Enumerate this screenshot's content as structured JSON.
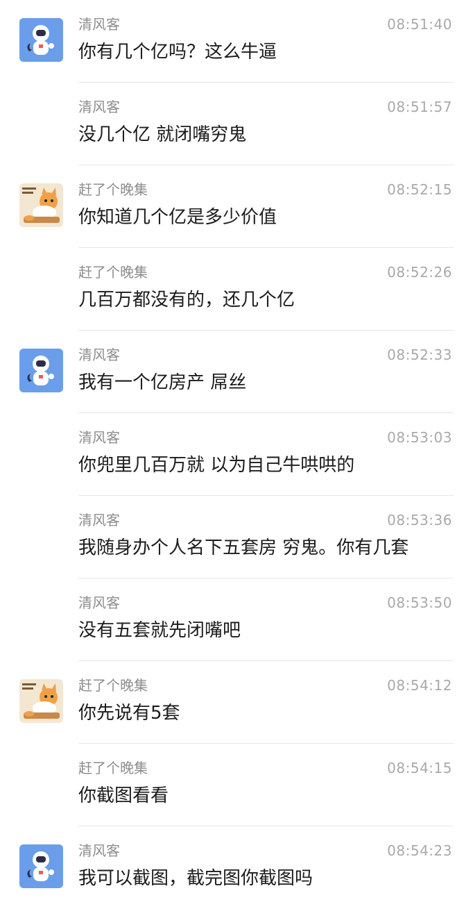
{
  "messages": [
    {
      "sender": "清风客",
      "time": "08:51:40",
      "text": "你有几个亿吗？这么牛逼",
      "avatar": "astronaut-avatar"
    },
    {
      "sender": "清风客",
      "time": "08:51:57",
      "text": "没几个亿 就闭嘴穷鬼",
      "avatar": ""
    },
    {
      "sender": "赶了个晚集",
      "time": "08:52:15",
      "text": "你知道几个亿是多少价值",
      "avatar": "cat-avatar"
    },
    {
      "sender": "赶了个晚集",
      "time": "08:52:26",
      "text": "几百万都没有的，还几个亿",
      "avatar": ""
    },
    {
      "sender": "清风客",
      "time": "08:52:33",
      "text": "我有一个亿房产 屌丝",
      "avatar": "astronaut-avatar"
    },
    {
      "sender": "清风客",
      "time": "08:53:03",
      "text": "你兜里几百万就 以为自己牛哄哄的",
      "avatar": ""
    },
    {
      "sender": "清风客",
      "time": "08:53:36",
      "text": "我随身办个人名下五套房 穷鬼。你有几套",
      "avatar": ""
    },
    {
      "sender": "清风客",
      "time": "08:53:50",
      "text": "没有五套就先闭嘴吧",
      "avatar": ""
    },
    {
      "sender": "赶了个晚集",
      "time": "08:54:12",
      "text": "你先说有5套",
      "avatar": "cat-avatar"
    },
    {
      "sender": "赶了个晚集",
      "time": "08:54:15",
      "text": "你截图看看",
      "avatar": ""
    },
    {
      "sender": "清风客",
      "time": "08:54:23",
      "text": "我可以截图，截完图你截图吗",
      "avatar": "astronaut-avatar"
    }
  ],
  "colors": {
    "astronaut_bg": "#6a9eea",
    "cat_bg": "#f3e7d2",
    "name": "#8d8d8d",
    "time": "#a9a9a9",
    "text": "#1b1b1b",
    "divider": "#e6e6e6"
  }
}
